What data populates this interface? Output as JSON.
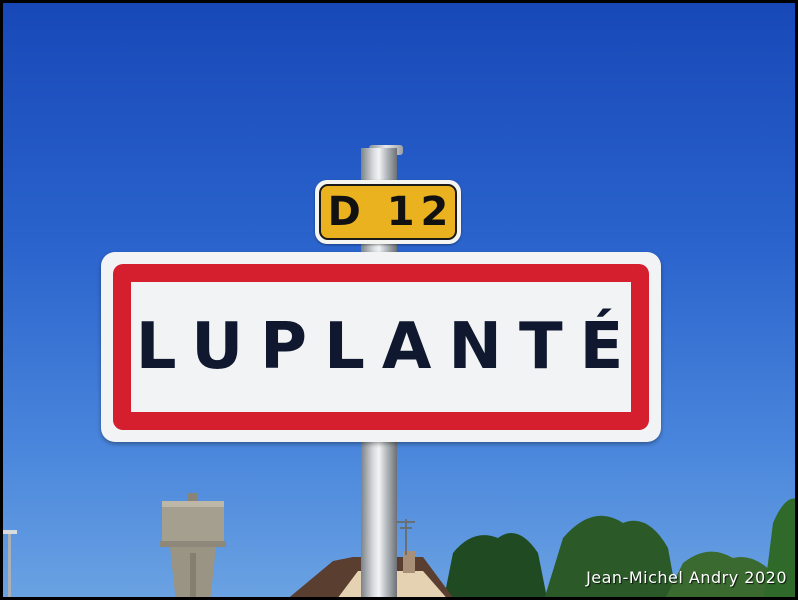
{
  "road_plate": {
    "number": "D 12",
    "background_color": "#e9b21e"
  },
  "town_sign": {
    "name": "LUPLANTÉ",
    "border_color": "#d51f2e"
  },
  "watermark": {
    "text": "Jean-Michel Andry 2020"
  },
  "scene": {
    "sky_color": "#2a63cc"
  }
}
